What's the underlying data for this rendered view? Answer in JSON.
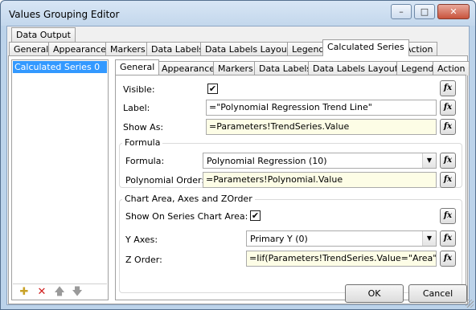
{
  "window": {
    "title": "Values Grouping Editor",
    "controls": {
      "minimize": "–",
      "maximize": "□",
      "close": "✕"
    }
  },
  "outer_tabs": {
    "row1": [
      "Data Output"
    ],
    "row2": [
      "General",
      "Appearance",
      "Markers",
      "Data Labels",
      "Data Labels Layout",
      "Legend",
      "Calculated Series",
      "Action"
    ],
    "active": "Calculated Series"
  },
  "series_list": {
    "items": [
      "Calculated Series 0"
    ],
    "toolbar_icons": [
      "new-icon",
      "delete-icon",
      "move-up-icon",
      "move-down-icon"
    ]
  },
  "inner_tabs": {
    "tabs": [
      "General",
      "Appearance",
      "Markers",
      "Data Labels",
      "Data Labels Layout",
      "Legend",
      "Action"
    ],
    "active": "General"
  },
  "general": {
    "visible_label": "Visible:",
    "visible_checked": true,
    "label_label": "Label:",
    "label_value": "=\"Polynomial Regression Trend Line\"",
    "show_as_label": "Show As:",
    "show_as_value": "=Parameters!TrendSeries.Value"
  },
  "formula_group": {
    "title": "Formula",
    "formula_label": "Formula:",
    "formula_value": "Polynomial Regression (10)",
    "order_label": "Polynomial Order:",
    "order_value": "=Parameters!Polynomial.Value"
  },
  "chart_area_group": {
    "title": "Chart Area, Axes and ZOrder",
    "show_on_series_label": "Show On Series Chart Area:",
    "show_on_series_checked": true,
    "y_axes_label": "Y Axes:",
    "y_axes_value": "Primary Y (0)",
    "zorder_label": "Z Order:",
    "zorder_value": "=Iif(Parameters!TrendSeries.Value=\"Area\" Or"
  },
  "fx_glyph": "fx",
  "check_glyph": "✔",
  "dropdown_glyph": "▼",
  "footer": {
    "ok": "OK",
    "cancel": "Cancel"
  },
  "colors": {
    "selection": "#3399ff",
    "expression_bg": "#fdfde6",
    "frame": "#bcd3ea"
  }
}
